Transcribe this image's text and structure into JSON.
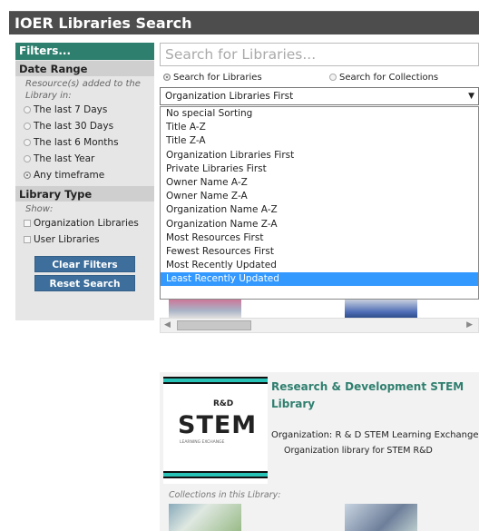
{
  "header": {
    "title": "IOER Libraries Search"
  },
  "filters": {
    "heading": "Filters...",
    "date_range": {
      "title": "Date Range",
      "note": "Resource(s) added to the Library in:",
      "options": [
        {
          "label": "The last 7 Days",
          "selected": false
        },
        {
          "label": "The last 30 Days",
          "selected": false
        },
        {
          "label": "The last 6 Months",
          "selected": false
        },
        {
          "label": "The last Year",
          "selected": false
        },
        {
          "label": "Any timeframe",
          "selected": true
        }
      ]
    },
    "library_type": {
      "title": "Library Type",
      "note": "Show:",
      "options": [
        {
          "label": "Organization Libraries",
          "checked": false
        },
        {
          "label": "User Libraries",
          "checked": false
        }
      ]
    },
    "clear_label": "Clear Filters",
    "reset_label": "Reset Search"
  },
  "search": {
    "placeholder": "Search for Libraries..."
  },
  "modes": {
    "libraries": "Search for Libraries",
    "collections": "Search for Collections",
    "selected": "libraries"
  },
  "sort": {
    "selected": "Organization Libraries First",
    "options": [
      "No special Sorting",
      "Title A-Z",
      "Title Z-A",
      "Organization Libraries First",
      "Private Libraries First",
      "Owner Name A-Z",
      "Owner Name Z-A",
      "Organization Name A-Z",
      "Organization Name Z-A",
      "Most Resources First",
      "Fewest Resources First",
      "Most Recently Updated",
      "Least Recently Updated"
    ],
    "highlighted": "Least Recently Updated"
  },
  "library": {
    "title": "Research & Development STEM Library",
    "organization": "Organization: R & D STEM Learning Exchange",
    "description": "Organization library for STEM R&D",
    "collections_label": "Collections in this Library:",
    "logo": {
      "badge": "R&D",
      "wordmark": "STEM",
      "tagline": "LEARNING EXCHANGE"
    }
  },
  "colors": {
    "header": "#4d4d4d",
    "filters_head": "#2f7f6f",
    "button": "#3d6e9c",
    "highlight": "#3399ff",
    "title": "#2f7f6f",
    "logo_bar": "#29c2b6"
  },
  "icons": {
    "dropdown": "triangle-down-icon",
    "scroll_left": "triangle-left-icon",
    "scroll_right": "triangle-right-icon"
  }
}
